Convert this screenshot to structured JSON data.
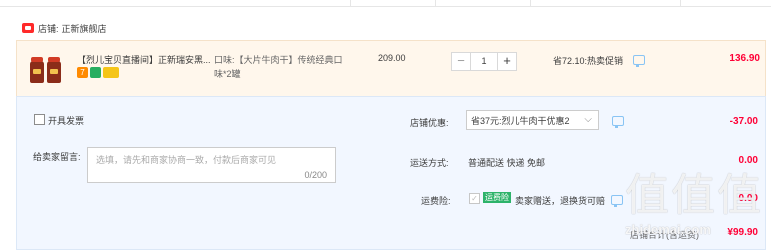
{
  "shop": {
    "label": "店铺:",
    "name": "正新旗舰店"
  },
  "item": {
    "title": "【烈儿宝贝直播间】正新瑞安黑...",
    "spec_line1": "口味:【大片牛肉干】传统经典口",
    "spec_line2": "味*2罐",
    "unit_price": "209.00",
    "qty": "1",
    "minus": "−",
    "plus": "+",
    "promo": "省72.10:热卖促销",
    "subtotal": "136.90",
    "badges": [
      "7",
      "",
      ""
    ]
  },
  "invoice": {
    "label": "开具发票"
  },
  "shop_discount": {
    "label": "店铺优惠:",
    "selected": "省37元:烈儿牛肉干优惠2",
    "amount": "-37.00"
  },
  "message": {
    "label": "给卖家留言:",
    "placeholder": "选填，请先和商家协商一致，付款后商家可见",
    "counter": "0/200"
  },
  "shipping": {
    "label": "运送方式:",
    "value": "普通配送 快递 免邮",
    "amount": "0.00"
  },
  "insurance": {
    "label": "运费险:",
    "tag": "运费险",
    "desc": "卖家赠送，退换货可赔",
    "amount": "0.00"
  },
  "total": {
    "label": "店铺合计(含运费)",
    "amount": "¥99.90"
  },
  "watermark": {
    "text": "值值值",
    "url": "zhidemai.com"
  },
  "colors": {
    "accent": "#ff0036",
    "item_bg": "#fff7ec",
    "lower_bg": "#f2f7ff"
  }
}
